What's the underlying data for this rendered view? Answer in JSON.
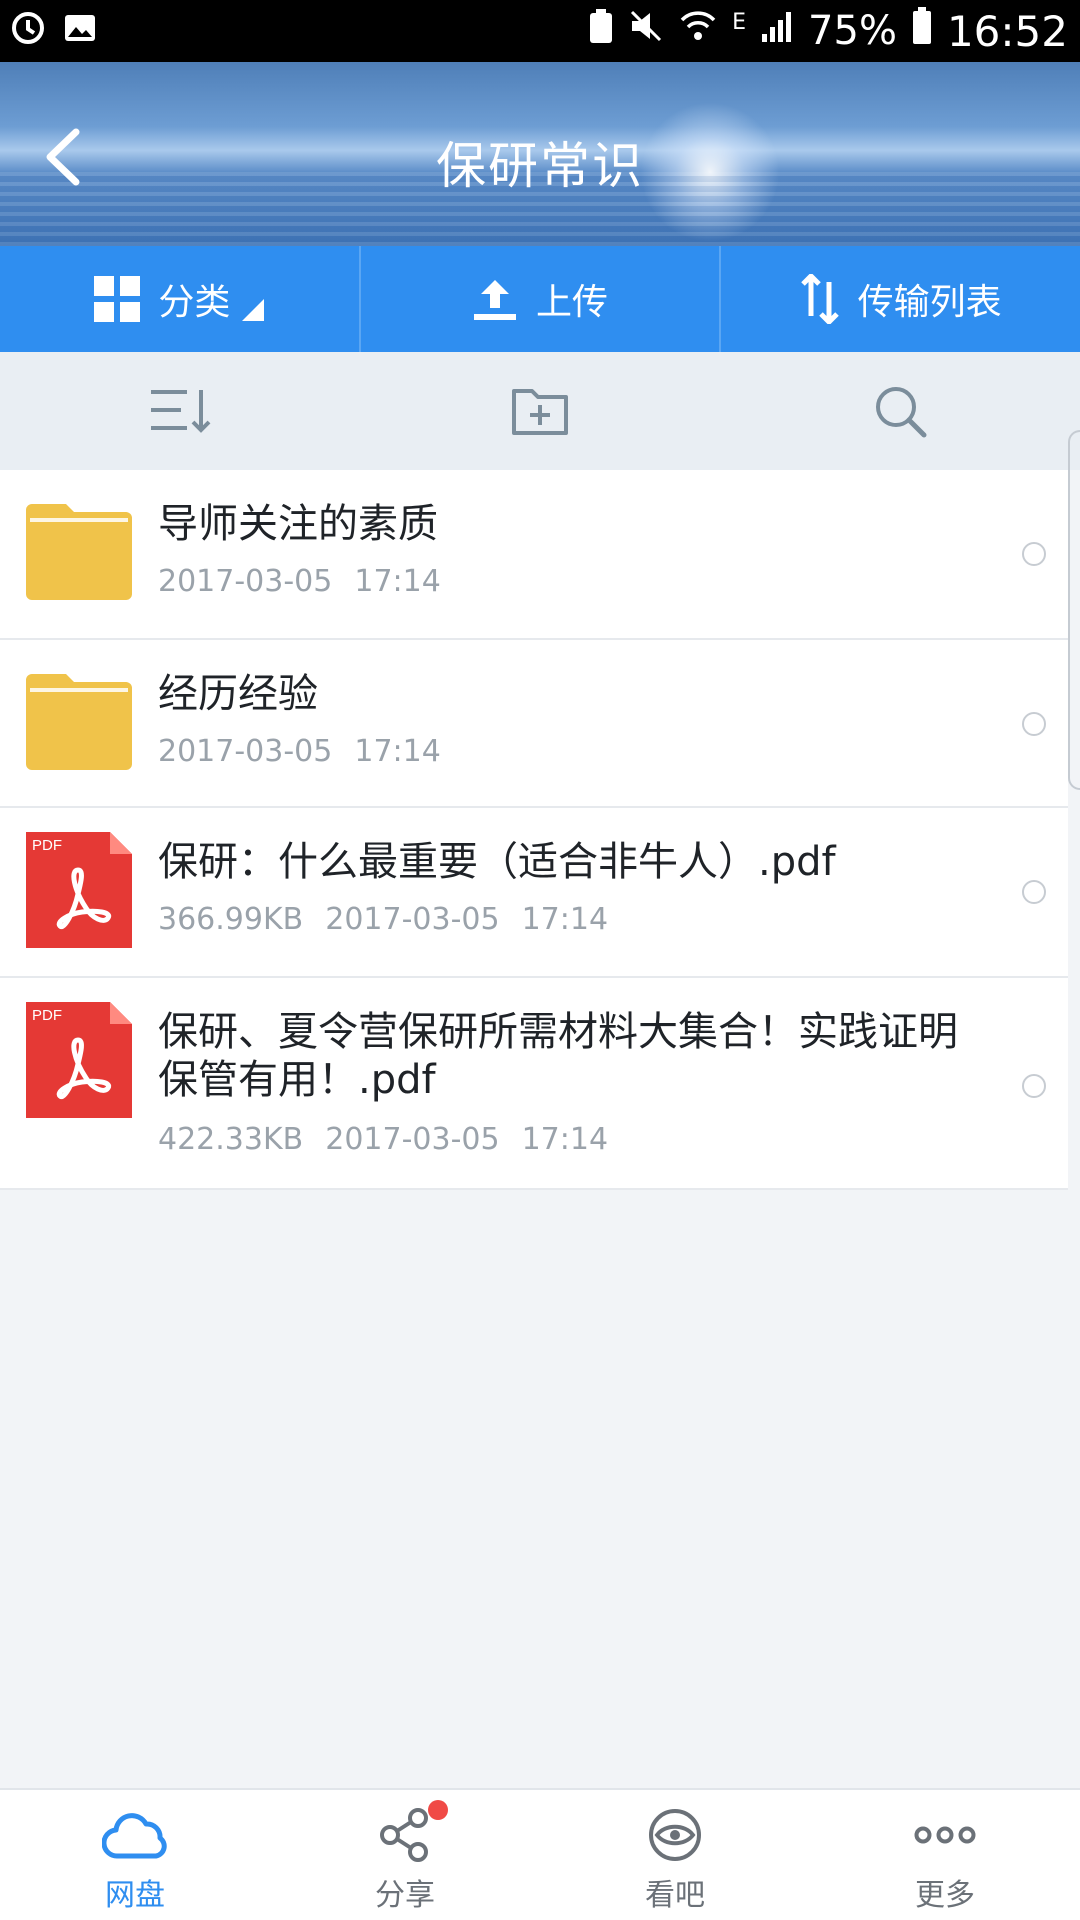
{
  "status_bar": {
    "battery": "75%",
    "time": "16:52",
    "network": "E"
  },
  "header": {
    "title": "保研常识"
  },
  "toolbar": {
    "category_label": "分类",
    "upload_label": "上传",
    "transfer_label": "传输列表"
  },
  "files": [
    {
      "type": "folder",
      "name": "导师关注的素质",
      "size": "",
      "date": "2017-03-05",
      "time": "17:14"
    },
    {
      "type": "folder",
      "name": "经历经验",
      "size": "",
      "date": "2017-03-05",
      "time": "17:14"
    },
    {
      "type": "pdf",
      "name": "保研：什么最重要（适合非牛人）.pdf",
      "size": "366.99KB",
      "date": "2017-03-05",
      "time": "17:14"
    },
    {
      "type": "pdf",
      "name_line1": "保研、夏令营保研所需材料大集合！实践证明",
      "name_line2": "保管有用！.pdf",
      "size": "422.33KB",
      "date": "2017-03-05",
      "time": "17:14"
    }
  ],
  "pdf_badge": "PDF",
  "bottom_nav": [
    {
      "label": "网盘",
      "icon": "cloud-icon",
      "active": true
    },
    {
      "label": "分享",
      "icon": "share-icon",
      "active": false
    },
    {
      "label": "看吧",
      "icon": "eye-icon",
      "active": false
    },
    {
      "label": "更多",
      "icon": "more-dots-icon",
      "active": false
    }
  ],
  "colors": {
    "accent": "#2f8ef0",
    "folder": "#f0c34a",
    "pdf": "#e53935",
    "badge": "#f04a46"
  }
}
